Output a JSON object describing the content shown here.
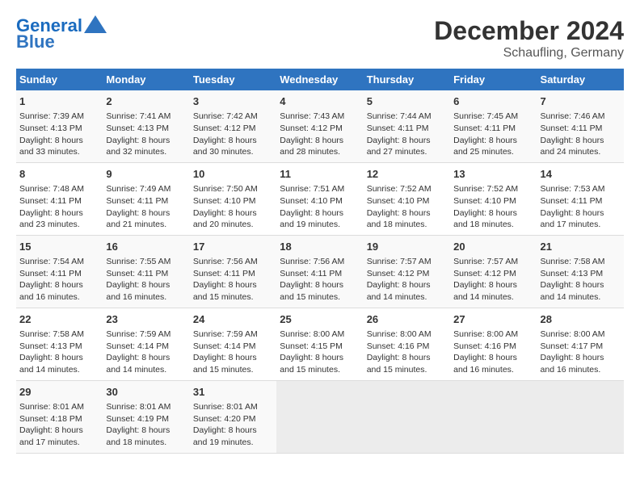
{
  "header": {
    "logo_line1": "General",
    "logo_line2": "Blue",
    "month_year": "December 2024",
    "location": "Schaufling, Germany"
  },
  "days_of_week": [
    "Sunday",
    "Monday",
    "Tuesday",
    "Wednesday",
    "Thursday",
    "Friday",
    "Saturday"
  ],
  "weeks": [
    [
      {
        "day": "1",
        "info": "Sunrise: 7:39 AM\nSunset: 4:13 PM\nDaylight: 8 hours\nand 33 minutes."
      },
      {
        "day": "2",
        "info": "Sunrise: 7:41 AM\nSunset: 4:13 PM\nDaylight: 8 hours\nand 32 minutes."
      },
      {
        "day": "3",
        "info": "Sunrise: 7:42 AM\nSunset: 4:12 PM\nDaylight: 8 hours\nand 30 minutes."
      },
      {
        "day": "4",
        "info": "Sunrise: 7:43 AM\nSunset: 4:12 PM\nDaylight: 8 hours\nand 28 minutes."
      },
      {
        "day": "5",
        "info": "Sunrise: 7:44 AM\nSunset: 4:11 PM\nDaylight: 8 hours\nand 27 minutes."
      },
      {
        "day": "6",
        "info": "Sunrise: 7:45 AM\nSunset: 4:11 PM\nDaylight: 8 hours\nand 25 minutes."
      },
      {
        "day": "7",
        "info": "Sunrise: 7:46 AM\nSunset: 4:11 PM\nDaylight: 8 hours\nand 24 minutes."
      }
    ],
    [
      {
        "day": "8",
        "info": "Sunrise: 7:48 AM\nSunset: 4:11 PM\nDaylight: 8 hours\nand 23 minutes."
      },
      {
        "day": "9",
        "info": "Sunrise: 7:49 AM\nSunset: 4:11 PM\nDaylight: 8 hours\nand 21 minutes."
      },
      {
        "day": "10",
        "info": "Sunrise: 7:50 AM\nSunset: 4:10 PM\nDaylight: 8 hours\nand 20 minutes."
      },
      {
        "day": "11",
        "info": "Sunrise: 7:51 AM\nSunset: 4:10 PM\nDaylight: 8 hours\nand 19 minutes."
      },
      {
        "day": "12",
        "info": "Sunrise: 7:52 AM\nSunset: 4:10 PM\nDaylight: 8 hours\nand 18 minutes."
      },
      {
        "day": "13",
        "info": "Sunrise: 7:52 AM\nSunset: 4:10 PM\nDaylight: 8 hours\nand 18 minutes."
      },
      {
        "day": "14",
        "info": "Sunrise: 7:53 AM\nSunset: 4:11 PM\nDaylight: 8 hours\nand 17 minutes."
      }
    ],
    [
      {
        "day": "15",
        "info": "Sunrise: 7:54 AM\nSunset: 4:11 PM\nDaylight: 8 hours\nand 16 minutes."
      },
      {
        "day": "16",
        "info": "Sunrise: 7:55 AM\nSunset: 4:11 PM\nDaylight: 8 hours\nand 16 minutes."
      },
      {
        "day": "17",
        "info": "Sunrise: 7:56 AM\nSunset: 4:11 PM\nDaylight: 8 hours\nand 15 minutes."
      },
      {
        "day": "18",
        "info": "Sunrise: 7:56 AM\nSunset: 4:11 PM\nDaylight: 8 hours\nand 15 minutes."
      },
      {
        "day": "19",
        "info": "Sunrise: 7:57 AM\nSunset: 4:12 PM\nDaylight: 8 hours\nand 14 minutes."
      },
      {
        "day": "20",
        "info": "Sunrise: 7:57 AM\nSunset: 4:12 PM\nDaylight: 8 hours\nand 14 minutes."
      },
      {
        "day": "21",
        "info": "Sunrise: 7:58 AM\nSunset: 4:13 PM\nDaylight: 8 hours\nand 14 minutes."
      }
    ],
    [
      {
        "day": "22",
        "info": "Sunrise: 7:58 AM\nSunset: 4:13 PM\nDaylight: 8 hours\nand 14 minutes."
      },
      {
        "day": "23",
        "info": "Sunrise: 7:59 AM\nSunset: 4:14 PM\nDaylight: 8 hours\nand 14 minutes."
      },
      {
        "day": "24",
        "info": "Sunrise: 7:59 AM\nSunset: 4:14 PM\nDaylight: 8 hours\nand 15 minutes."
      },
      {
        "day": "25",
        "info": "Sunrise: 8:00 AM\nSunset: 4:15 PM\nDaylight: 8 hours\nand 15 minutes."
      },
      {
        "day": "26",
        "info": "Sunrise: 8:00 AM\nSunset: 4:16 PM\nDaylight: 8 hours\nand 15 minutes."
      },
      {
        "day": "27",
        "info": "Sunrise: 8:00 AM\nSunset: 4:16 PM\nDaylight: 8 hours\nand 16 minutes."
      },
      {
        "day": "28",
        "info": "Sunrise: 8:00 AM\nSunset: 4:17 PM\nDaylight: 8 hours\nand 16 minutes."
      }
    ],
    [
      {
        "day": "29",
        "info": "Sunrise: 8:01 AM\nSunset: 4:18 PM\nDaylight: 8 hours\nand 17 minutes."
      },
      {
        "day": "30",
        "info": "Sunrise: 8:01 AM\nSunset: 4:19 PM\nDaylight: 8 hours\nand 18 minutes."
      },
      {
        "day": "31",
        "info": "Sunrise: 8:01 AM\nSunset: 4:20 PM\nDaylight: 8 hours\nand 19 minutes."
      },
      null,
      null,
      null,
      null
    ]
  ]
}
